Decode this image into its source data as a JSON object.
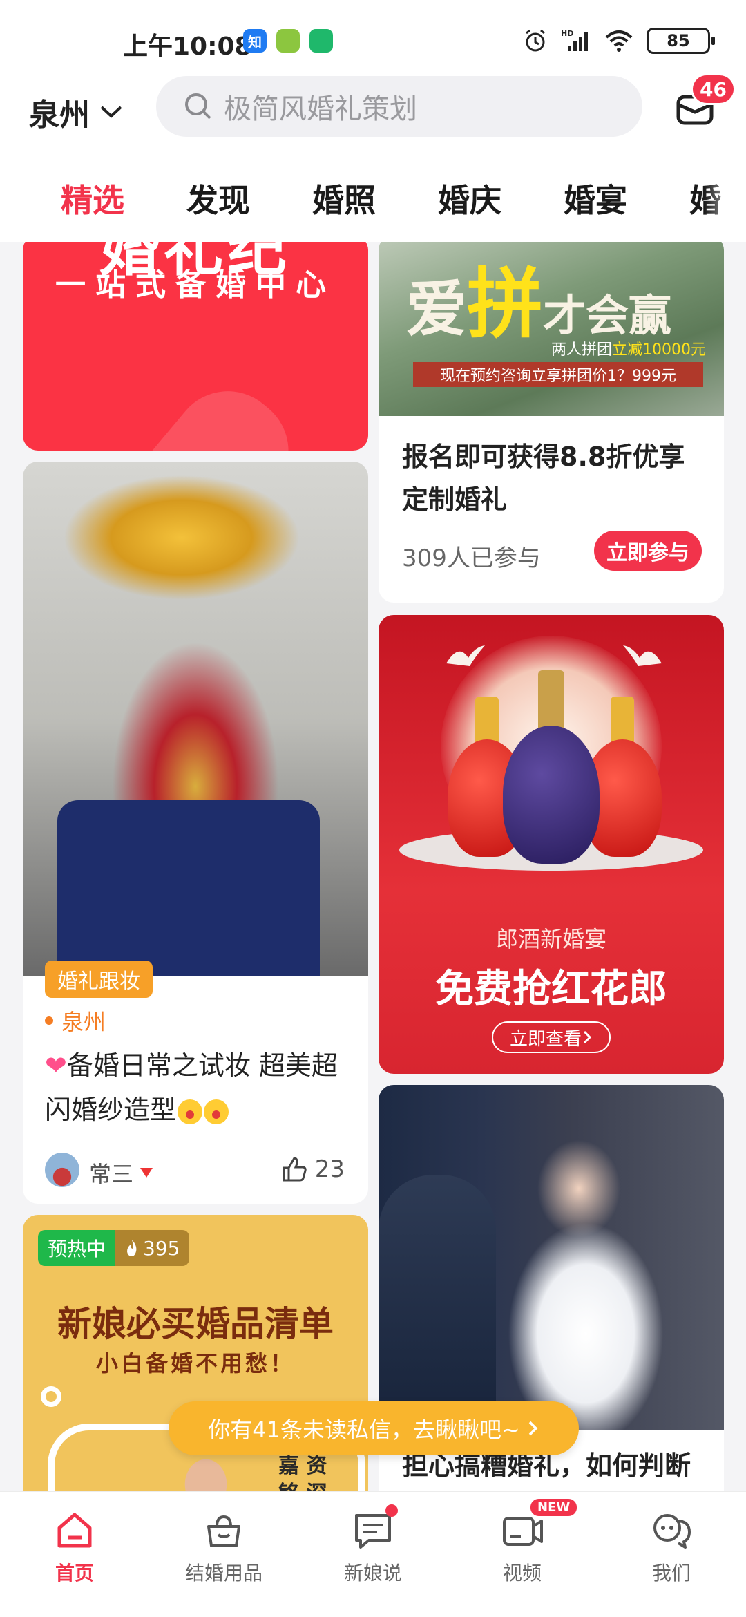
{
  "status": {
    "time": "上午10:08",
    "apps": [
      {
        "icon": "zhihu-app-icon",
        "label": "知",
        "color": "#1f7bf2"
      },
      {
        "icon": "music-app-icon",
        "label": "",
        "color": "#8cc63f"
      },
      {
        "icon": "green-app-icon",
        "label": "",
        "color": "#1fb86b"
      }
    ],
    "battery": "85"
  },
  "header": {
    "city": "泉州",
    "search_placeholder": "极简风婚礼策划",
    "message_badge": "46"
  },
  "tabs": [
    {
      "label": "精选",
      "active": true
    },
    {
      "label": "发现"
    },
    {
      "label": "婚照"
    },
    {
      "label": "婚庆"
    },
    {
      "label": "婚宴"
    },
    {
      "label": "婚"
    }
  ],
  "feed": {
    "banner_top": {
      "headline": "婚礼纪",
      "subtitle": "一站式备婚中心"
    },
    "promo": {
      "image_title_a": "爱",
      "image_title_b": "拼",
      "image_title_c": "才会赢",
      "image_line_a": "两人拼团",
      "image_line_b": "立减10000元",
      "image_bar": "现在预约咨询立享拼团价1？999元",
      "title": "报名即可获得8.8折优享定制婚礼",
      "count": "309人已参与",
      "button": "立即参与"
    },
    "post_makeup": {
      "tag": "婚礼跟妆",
      "location": "泉州",
      "title": "备婚日常之试妆 超美超闪婚纱造型",
      "author": "常三",
      "likes": "23"
    },
    "wine_ad": {
      "subtitle": "郎酒新婚宴",
      "headline": "免费抢红花郎",
      "button": "立即查看"
    },
    "shopping": {
      "badge": "预热中",
      "heat": "395",
      "title": "新娘必买婚品清单",
      "subtitle": "小白备婚不用愁！",
      "side_text_1": "嘉  资",
      "side_text_2": "铭  深"
    },
    "wedding_post": {
      "title": "担心搞糟婚礼，如何判断"
    }
  },
  "toast": {
    "text": "你有41条未读私信，去瞅瞅吧~"
  },
  "bottom_nav": [
    {
      "label": "首页",
      "icon": "home-icon",
      "active": true
    },
    {
      "label": "结婚用品",
      "icon": "shopping-bag-icon"
    },
    {
      "label": "新娘说",
      "icon": "chat-icon"
    },
    {
      "label": "视频",
      "icon": "video-icon",
      "badge": "NEW"
    },
    {
      "label": "我们",
      "icon": "couple-chat-icon"
    }
  ],
  "colors": {
    "accent": "#f2334b",
    "toast": "#f9b52d",
    "tag_orange": "#f7a028"
  }
}
